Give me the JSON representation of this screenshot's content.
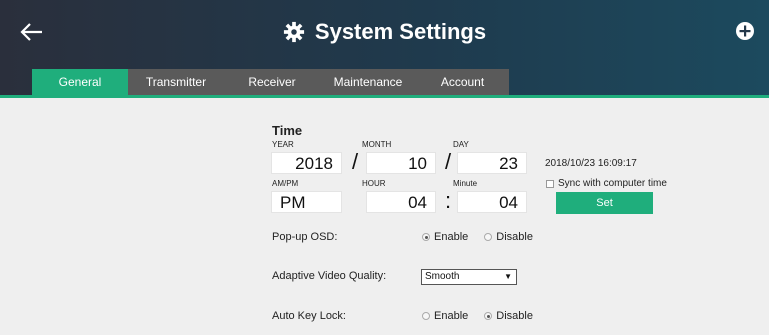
{
  "header": {
    "title": "System Settings",
    "icons": {
      "back": "back-arrow-icon",
      "settings": "gear-icon",
      "add": "plus-circle-icon"
    }
  },
  "tabs": [
    {
      "label": "General",
      "active": true
    },
    {
      "label": "Transmitter",
      "active": false
    },
    {
      "label": "Receiver",
      "active": false
    },
    {
      "label": "Maintenance",
      "active": false
    },
    {
      "label": "Account",
      "active": false
    }
  ],
  "time": {
    "title": "Time",
    "labels": {
      "year": "YEAR",
      "month": "MONTH",
      "day": "DAY",
      "ampm": "AM/PM",
      "hour": "HOUR",
      "minute": "Minute"
    },
    "values": {
      "year": "2018",
      "month": "10",
      "day": "23",
      "ampm": "PM",
      "hour": "04",
      "minute": "04"
    },
    "date_sep": "/",
    "time_sep": ":",
    "current_datetime": "2018/10/23 16:09:17",
    "sync_label": "Sync with computer time",
    "sync_checked": false,
    "set_label": "Set"
  },
  "popup_osd": {
    "label": "Pop-up OSD:",
    "enable": "Enable",
    "disable": "Disable",
    "selected": "Enable"
  },
  "adaptive_video": {
    "label": "Adaptive Video Quality:",
    "value": "Smooth"
  },
  "auto_key_lock": {
    "label": "Auto Key Lock:",
    "enable": "Enable",
    "disable": "Disable",
    "selected": "Disable"
  },
  "colors": {
    "accent": "#1fae7c",
    "tab_inactive": "#5a5a5a",
    "background": "#efefef"
  }
}
